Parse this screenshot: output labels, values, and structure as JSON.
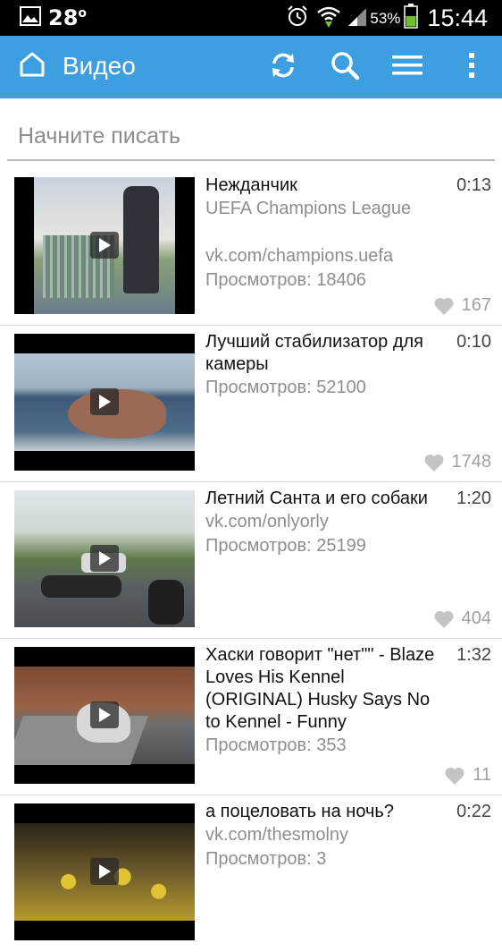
{
  "status_bar": {
    "temperature": "28",
    "battery_percent": "53%",
    "time": "15:44"
  },
  "app_bar": {
    "title": "Видео",
    "color": "#3e9fe0"
  },
  "search": {
    "placeholder": "Начните писать"
  },
  "videos": [
    {
      "title": "Нежданчик",
      "duration": "0:13",
      "author": "UEFA Champions League",
      "link": "vk.com/champions.uefa",
      "views": "Просмотров: 18406",
      "likes": "167"
    },
    {
      "title": "Лучший стабилизатор для камеры",
      "duration": "0:10",
      "views": "Просмотров: 52100",
      "likes": "1748"
    },
    {
      "title": "Летний Санта и его собаки",
      "duration": "1:20",
      "link": "vk.com/onlyorly",
      "views": "Просмотров: 25199",
      "likes": "404"
    },
    {
      "title": "Хаски говорит \"нет\"\" - Blaze Loves His Kennel (ORIGINAL) Husky Says No to Kennel - Funny",
      "duration": "1:32",
      "views": "Просмотров: 353",
      "likes": "11"
    },
    {
      "title": "а поцеловать на ночь?",
      "duration": "0:22",
      "link": "vk.com/thesmolny",
      "views": "Просмотров: 3"
    }
  ]
}
